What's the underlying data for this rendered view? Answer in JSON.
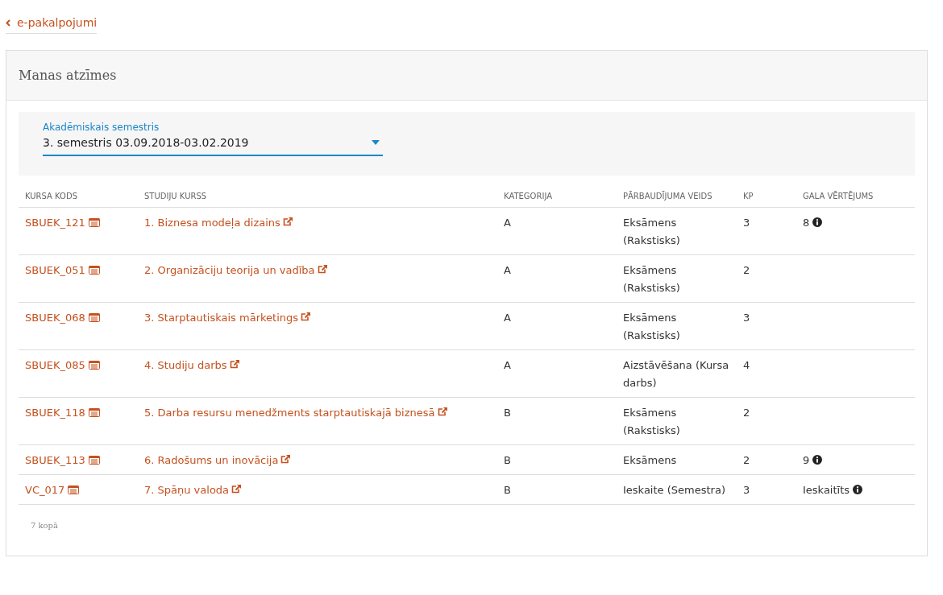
{
  "back_link": {
    "label": "e-pakalpojumi"
  },
  "panel": {
    "title": "Manas atzīmes"
  },
  "semester_select": {
    "label": "Akadēmiskais semestris",
    "value": "3. semestris 03.09.2018-03.02.2019"
  },
  "table": {
    "columns": [
      "KURSA KODS",
      "STUDIJU KURSS",
      "KATEGORIJA",
      "PĀRBAUDĪJUMA VEIDS",
      "KP",
      "GALA VĒRTĒJUMS"
    ],
    "rows": [
      {
        "code": "SBUEK_121",
        "course": "1. Biznesa modeļa dizains",
        "category": "A",
        "exam": "Eksāmens (Rakstisks)",
        "kp": "3",
        "grade": "8"
      },
      {
        "code": "SBUEK_051",
        "course": "2. Organizāciju teorija un vadība",
        "category": "A",
        "exam": "Eksāmens (Rakstisks)",
        "kp": "2"
      },
      {
        "code": "SBUEK_068",
        "course": "3. Starptautiskais mārketings",
        "category": "A",
        "exam": "Eksāmens (Rakstisks)",
        "kp": "3"
      },
      {
        "code": "SBUEK_085",
        "course": "4. Studiju darbs",
        "category": "A",
        "exam": "Aizstāvēšana (Kursa darbs)",
        "kp": "4"
      },
      {
        "code": "SBUEK_118",
        "course": "5. Darba resursu menedžments starptautiskajā biznesā",
        "category": "B",
        "exam": "Eksāmens (Rakstisks)",
        "kp": "2"
      },
      {
        "code": "SBUEK_113",
        "course": "6. Radošums un inovācija",
        "category": "B",
        "exam": "Eksāmens",
        "kp": "2",
        "grade": "9"
      },
      {
        "code": "VC_017",
        "course": "7. Spāņu valoda",
        "category": "B",
        "exam": "Ieskaite (Semestra)",
        "kp": "3",
        "grade": "Ieskaitīts"
      }
    ]
  },
  "total": "7 kopā"
}
